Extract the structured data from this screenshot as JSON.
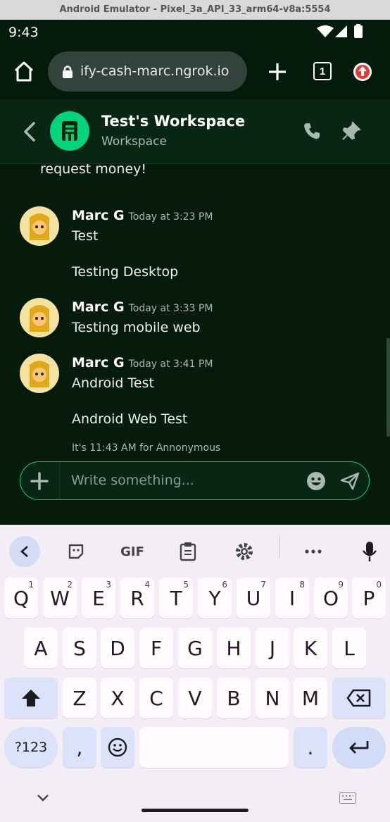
{
  "emulator": {
    "title": "Android Emulator - Pixel_3a_API_33_arm64-v8a:5554"
  },
  "status": {
    "time": "9:43"
  },
  "browser": {
    "url": "ify-cash-marc.ngrok.io",
    "tab_count": "1"
  },
  "header": {
    "title": "Test's Workspace",
    "subtitle": "Workspace"
  },
  "chat": {
    "partial_text": "request money!",
    "groups": [
      {
        "author": "Marc G",
        "time": "Today at 3:23 PM",
        "messages": [
          "Test",
          "Testing Desktop"
        ]
      },
      {
        "author": "Marc G",
        "time": "Today at 3:33 PM",
        "messages": [
          "Testing mobile web"
        ]
      },
      {
        "author": "Marc G",
        "time": "Today at 3:41 PM",
        "messages": [
          "Android Test",
          "Android Web Test"
        ]
      }
    ],
    "local_time_note": "It's 11:43 AM for Annonymous"
  },
  "composer": {
    "placeholder": "Write something..."
  },
  "keyboard": {
    "row1": [
      {
        "k": "Q",
        "n": "1"
      },
      {
        "k": "W",
        "n": "2"
      },
      {
        "k": "E",
        "n": "3"
      },
      {
        "k": "R",
        "n": "4"
      },
      {
        "k": "T",
        "n": "5"
      },
      {
        "k": "Y",
        "n": "6"
      },
      {
        "k": "U",
        "n": "7"
      },
      {
        "k": "I",
        "n": "8"
      },
      {
        "k": "O",
        "n": "9"
      },
      {
        "k": "P",
        "n": "0"
      }
    ],
    "row2": [
      "A",
      "S",
      "D",
      "F",
      "G",
      "H",
      "J",
      "K",
      "L"
    ],
    "row3": [
      "Z",
      "X",
      "C",
      "V",
      "B",
      "N",
      "M"
    ],
    "symbols_label": "?123",
    "comma": ",",
    "period": ".",
    "gif_label": "GIF"
  },
  "colors": {
    "accent": "#03d47c",
    "background": "#061b0b",
    "header": "#072614"
  }
}
